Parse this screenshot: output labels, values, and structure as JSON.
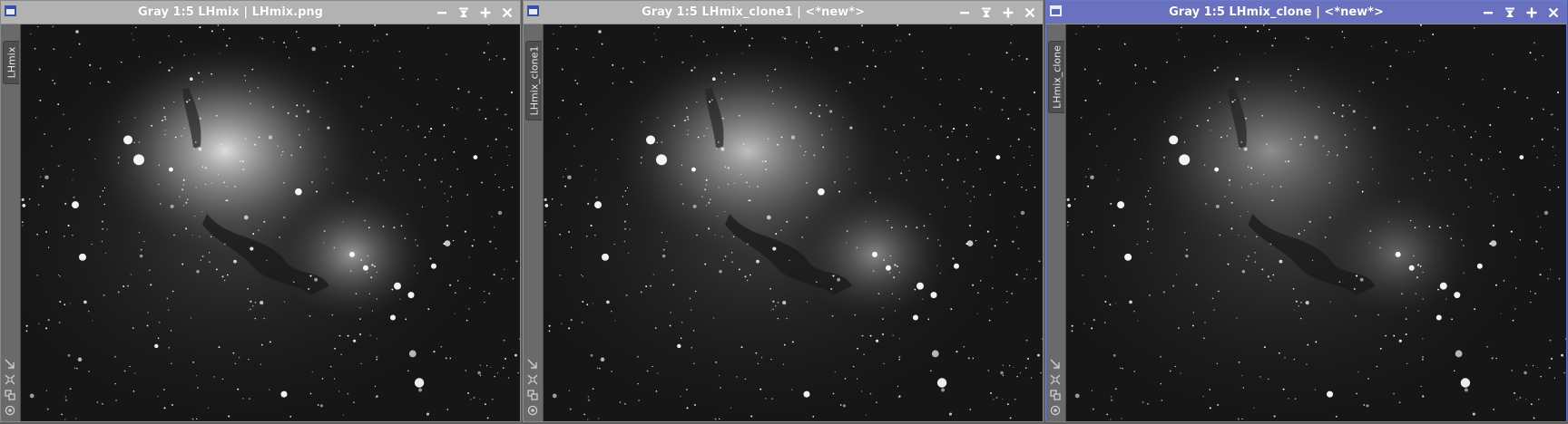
{
  "windows": [
    {
      "title": "Gray 1:5 LHmix | LHmix.png",
      "tab_label": "LHmix",
      "active": false,
      "buttons": [
        "minimize-icon",
        "shade-icon",
        "maximize-icon",
        "close-icon"
      ],
      "side_tools": [
        "arrow-icon",
        "fit-icon",
        "clone-icon",
        "target-icon"
      ]
    },
    {
      "title": "Gray 1:5 LHmix_clone1 | <*new*>",
      "tab_label": "LHmix_clone1",
      "active": false,
      "buttons": [
        "minimize-icon",
        "shade-icon",
        "maximize-icon",
        "close-icon"
      ],
      "side_tools": [
        "arrow-icon",
        "fit-icon",
        "clone-icon",
        "target-icon"
      ]
    },
    {
      "title": "Gray 1:5 LHmix_clone | <*new*>",
      "tab_label": "LHmix_clone",
      "active": true,
      "buttons": [
        "minimize-icon",
        "shade-icon",
        "maximize-icon",
        "close-icon"
      ],
      "side_tools": [
        "arrow-icon",
        "fit-icon",
        "clone-icon",
        "target-icon"
      ]
    }
  ],
  "colors": {
    "titlebar_inactive": "#b2b2b2",
    "titlebar_active": "#6a72bf",
    "workspace": "#5e5e5e",
    "image_background": "#141414"
  }
}
